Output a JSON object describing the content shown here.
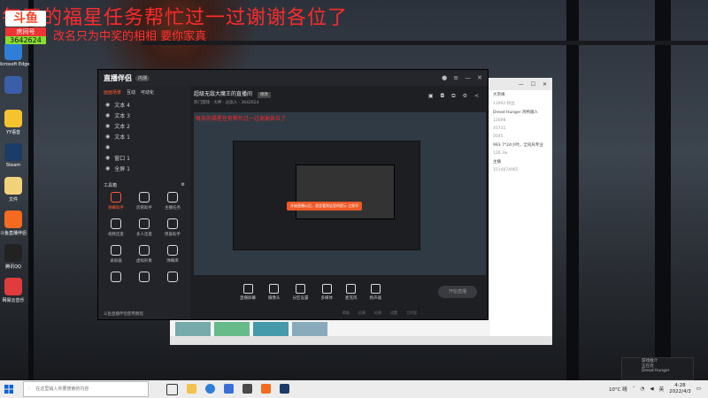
{
  "overlay": {
    "title": "每天的福星任务帮忙过一过谢谢各位了",
    "subtitle": "改名只为中奖的相相 要你家真",
    "room_label": "房间号",
    "room_number": "3642624"
  },
  "desktop_icons": [
    {
      "label": "Microsoft Edge",
      "color": "#2f7ed8"
    },
    {
      "label": "",
      "color": "#3a5fa8"
    },
    {
      "label": "YY语音",
      "color": "#f5c32d"
    },
    {
      "label": "Steam",
      "color": "#1b3c66"
    },
    {
      "label": "文件",
      "color": "#f0d27a"
    },
    {
      "label": "斗鱼直播伴侣",
      "color": "#f46b1f"
    },
    {
      "label": "腾讯QQ",
      "color": "#222222"
    },
    {
      "label": "网易云音乐",
      "color": "#e13c3c"
    }
  ],
  "app": {
    "brand": "直播伴侣",
    "beta": "内测",
    "tabs": [
      "画面场景",
      "互动",
      "可动化"
    ],
    "sources": [
      "文本 4",
      "文本 3",
      "文本 2",
      "文本 1",
      "",
      "窗口 1",
      "全屏 1"
    ],
    "tools_title": "工具箱",
    "tools": [
      {
        "label": "弹幕助手",
        "on": true
      },
      {
        "label": "房管助手",
        "on": false
      },
      {
        "label": "主播任务",
        "on": false
      },
      {
        "label": "视频连麦",
        "on": false
      },
      {
        "label": "多人连麦",
        "on": false
      },
      {
        "label": "惊喜助手",
        "on": false
      },
      {
        "label": "录屏器",
        "on": false
      },
      {
        "label": "虚拟形象",
        "on": false
      },
      {
        "label": "弹幕库",
        "on": false
      },
      {
        "label": "",
        "on": false
      },
      {
        "label": "",
        "on": false
      },
      {
        "label": "",
        "on": false
      }
    ],
    "hint": "斗鱼直播伴侣使用教程",
    "room_title": "超级无敌大魔王的直播间",
    "room_tag": "修改",
    "room_meta": [
      "热门游戏 · 大神",
      "过滤人",
      "3642624"
    ],
    "preview_overlay": "每天的福星任务帮忙过一过谢谢各位了",
    "preview_banner": "开始直播以后，就会看到这里的提示 立即开",
    "bottom_tools": [
      "直播屏幕",
      "摄像头",
      "分区设置",
      "多媒体",
      "麦克风",
      "扬声器"
    ],
    "start_label": "开始直播",
    "bottom_links": [
      "帮助",
      "反馈",
      "检测",
      "设置",
      "工作室"
    ]
  },
  "chat": [
    {
      "text": "大宗缘",
      "lbl": false
    },
    {
      "text": "13992 粉丝",
      "lbl": true
    },
    {
      "text": "Dread Hunger 鸡鸭捕人",
      "lbl": false
    },
    {
      "text": "12698",
      "lbl": true
    },
    {
      "text": "45731",
      "lbl": true
    },
    {
      "text": "0045",
      "lbl": true
    },
    {
      "text": "993 7*24小时，全同局专业",
      "lbl": false
    },
    {
      "text": "126.3w",
      "lbl": true
    },
    {
      "text": "主播",
      "lbl": false
    },
    {
      "text": "1014074965",
      "lbl": true
    }
  ],
  "notify": {
    "line1": "游戏推介",
    "line2": "正在玩",
    "line3": "Dread Hunger"
  },
  "taskbar": {
    "search_placeholder": "在这里输入你要搜索的内容",
    "temp": "10°C 晴",
    "lang": "英",
    "time": "4:28",
    "date": "2022/4/3"
  }
}
